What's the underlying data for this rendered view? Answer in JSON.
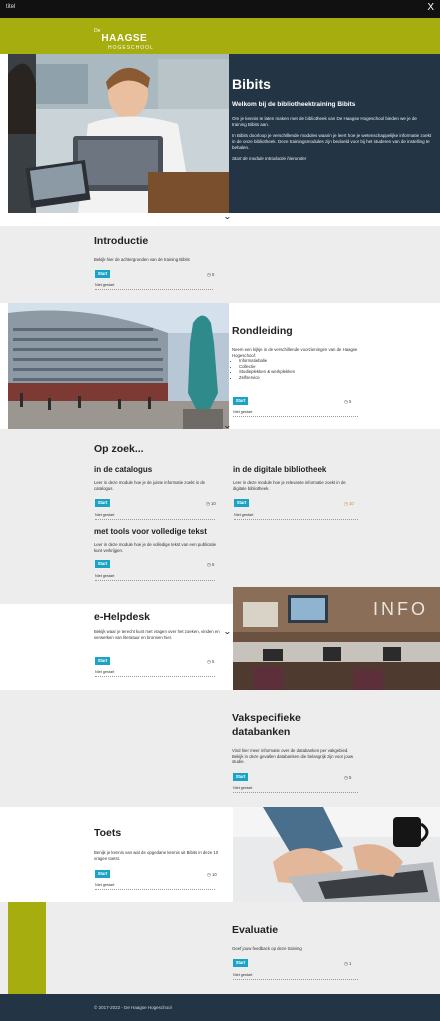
{
  "topbar": {
    "title": "titel",
    "close": "X"
  },
  "brand": {
    "prefix": "De",
    "name": "HAAGSE",
    "sub": "HOGESCHOOL"
  },
  "hero": {
    "title": "Bibits",
    "subtitle": "Welkom bij de bibliotheektraining Bibits",
    "p1": "Om je kennis te laten maken met de bibliotheek van De Haagse Hogeschool bieden we je de training Bibits aan.",
    "p2": "In Bibits doorloop je verschillende modules waarin je leert hoe je wetenschappelijke informatie zoekt in de onze bibliotheek. Deze trainingsmodules zijn bedoeld voor bij het studeren van de instelling te behalen.",
    "cta": "Start de module Introductie hieronder"
  },
  "introductie": {
    "title": "Introductie",
    "desc": "Bekijk hier de achtergronden van de training Bibits",
    "start": "Start",
    "minutes": "5",
    "status": "Niet gestart"
  },
  "rondleiding": {
    "title": "Rondleiding",
    "desc": "Neem een kijkje in de verschillende voorzieningen van de Haagse Hogeschool:",
    "items": [
      "Informatiebalie",
      "Collectie",
      "Studieplekken & werkplekken",
      "Zelfservice"
    ],
    "start": "Start",
    "minutes": "5",
    "status": "Niet gestart"
  },
  "opzoek": {
    "heading": "Op zoek...",
    "catalogus": {
      "title": "in de catalogus",
      "desc": "Leer in deze module hoe je de juiste informatie zoekt in de catalogus.",
      "start": "Start",
      "minutes": "10",
      "status": "Niet gestart"
    },
    "digitaal": {
      "title": "in de digitale bibliotheek",
      "desc": "Leer in deze module hoe je relevante informatie zoekt in de digitale bibliotheek.",
      "start": "Start",
      "minutes": "10",
      "status": "Niet gestart"
    },
    "tools": {
      "title": "met tools voor volledige tekst",
      "desc": "Leer in deze module hoe je de volledige tekst van een publicatie kunt verkrijgen.",
      "start": "Start",
      "minutes": "5",
      "status": "Niet gestart"
    }
  },
  "helpdesk": {
    "title": "e-Helpdesk",
    "desc": "Bekijk waar je terecht kunt met vragen over het zoeken, vinden en verwerken van literatuur en bronnen hier.",
    "start": "Start",
    "minutes": "5",
    "status": "Niet gestart",
    "sign": "INFO"
  },
  "vakspecifiek": {
    "title": "Vakspecifieke databanken",
    "desc": "Vind hier meer informatie over de databanken per vakgebied. Bekijk in deze gevallen databanken die belangrijk zijn voor jouw studie.",
    "start": "Start",
    "minutes": "5",
    "status": "Niet gestart"
  },
  "toets": {
    "title": "Toets",
    "desc": "Benijk je kennis van wat de opgedane kennis uit Bibits in deze 10 vragen toetst.",
    "start": "Start",
    "minutes": "10",
    "status": "Niet gestart"
  },
  "evaluatie": {
    "title": "Evaluatie",
    "desc": "Geef jouw feedback op deze training",
    "start": "Start",
    "minutes": "1",
    "status": "Niet gestart"
  },
  "footer": {
    "copyright": "© 2017-2022 - De Haagse Hogeschool"
  },
  "colors": {
    "brand_green": "#a5ad0f",
    "navy": "#233545",
    "start_blue": "#1ba3c6",
    "section_gray": "#ededed"
  }
}
